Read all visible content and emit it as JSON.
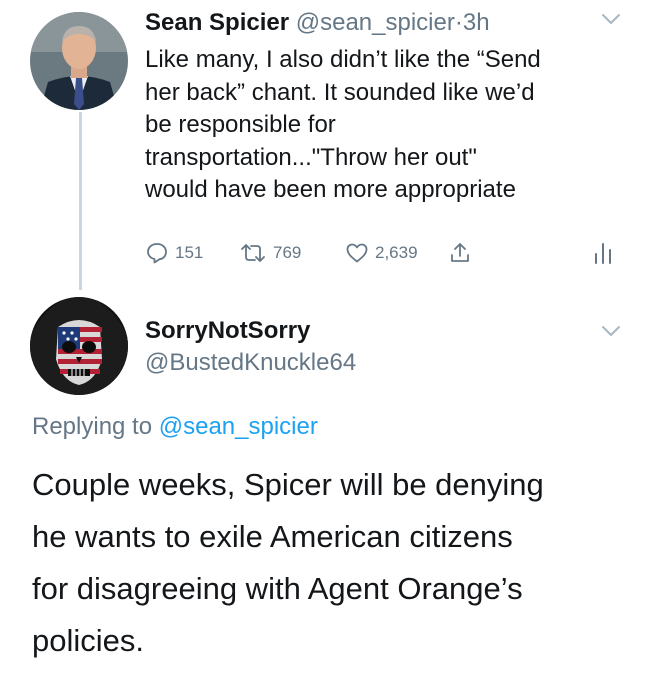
{
  "tweet_original": {
    "author_name": "Sean Spicier",
    "handle": "@sean_spicier",
    "separator": "·",
    "time": "3h",
    "text_lines": [
      "Like many, I also didn’t like the “Send",
      "her back” chant. It sounded like we’d",
      "be responsible for",
      "transportation...\"Throw her out\"",
      "would have been more appropriate"
    ],
    "stats": {
      "replies": "151",
      "retweets": "769",
      "likes": "2,639"
    },
    "icons": {
      "reply": "reply-icon",
      "retweet": "retweet-icon",
      "like": "heart-icon",
      "share": "share-icon",
      "analytics": "analytics-icon",
      "menu": "chevron-down-icon"
    }
  },
  "tweet_reply": {
    "author_name": "SorryNotSorry",
    "handle": "@BustedKnuckle64",
    "replying_prefix": "Replying to",
    "replying_to": "@sean_spicier",
    "text_lines": [
      "Couple weeks, Spicer will be denying",
      "he wants to exile American citizens",
      "for disagreeing with Agent Orange’s",
      "policies."
    ]
  },
  "colors": {
    "primary_text": "#14171a",
    "secondary_text": "#657786",
    "link": "#1da1f2",
    "thread_line": "#ccd6dd"
  }
}
